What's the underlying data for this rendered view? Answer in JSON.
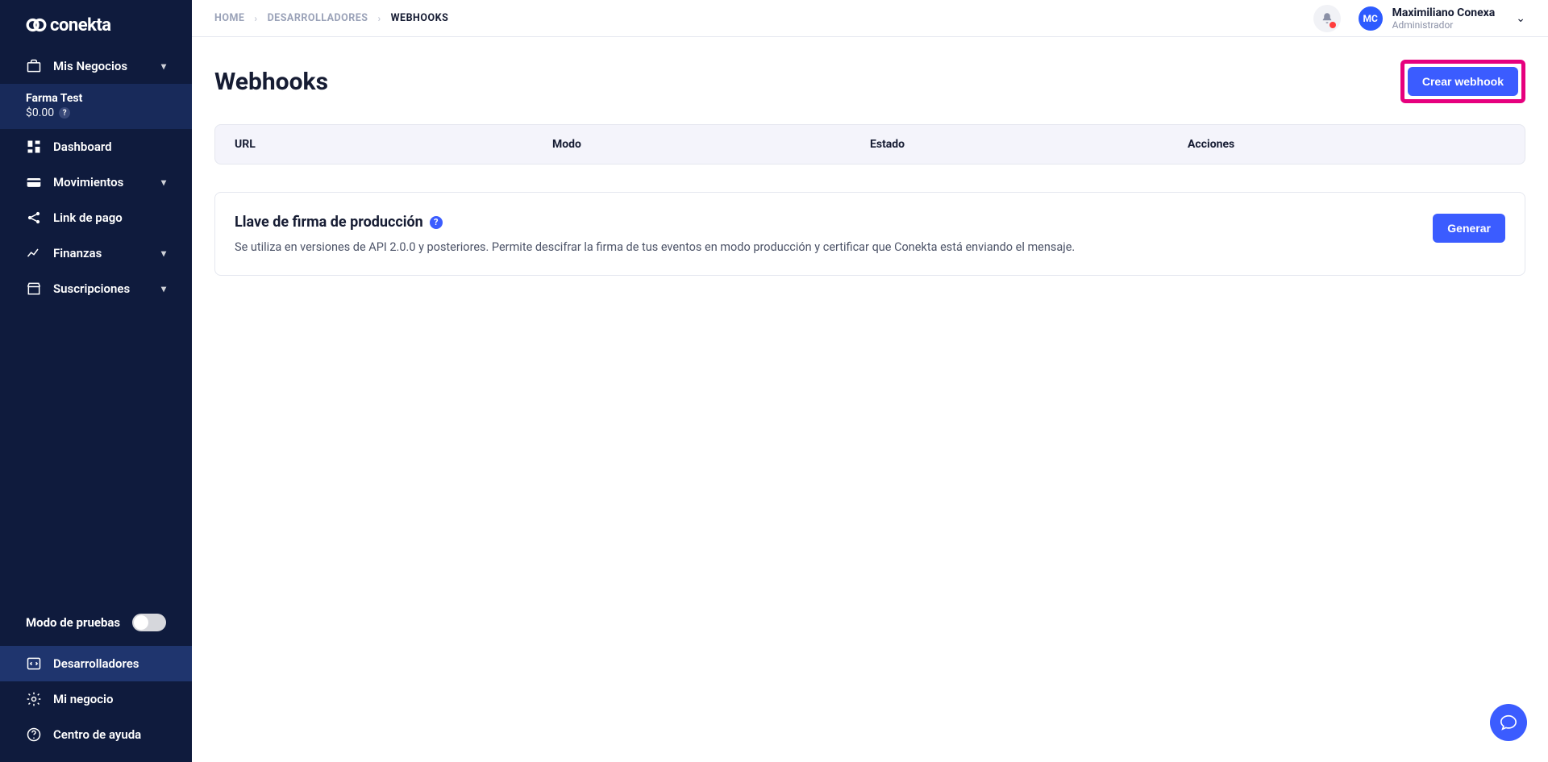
{
  "brand": {
    "name": "conekta"
  },
  "sidebar": {
    "misNegocios": "Mis Negocios",
    "account": {
      "name": "Farma Test",
      "balance": "$0.00"
    },
    "items": {
      "dashboard": "Dashboard",
      "movimientos": "Movimientos",
      "linkPago": "Link de pago",
      "finanzas": "Finanzas",
      "suscripciones": "Suscripciones"
    },
    "testMode": "Modo de pruebas",
    "bottom": {
      "desarrolladores": "Desarrolladores",
      "miNegocio": "Mi negocio",
      "centroAyuda": "Centro de ayuda"
    }
  },
  "breadcrumb": {
    "home": "HOME",
    "dev": "DESARROLLADORES",
    "current": "WEBHOOKS"
  },
  "user": {
    "initials": "MC",
    "name": "Maximiliano Conexa",
    "role": "Administrador"
  },
  "page": {
    "title": "Webhooks",
    "createButton": "Crear webhook",
    "columns": {
      "url": "URL",
      "modo": "Modo",
      "estado": "Estado",
      "acciones": "Acciones"
    },
    "signing": {
      "title": "Llave de firma de producción",
      "desc": "Se utiliza en versiones de API 2.0.0 y posteriores. Permite descifrar la firma de tus eventos en modo producción y certificar que Conekta está enviando el mensaje.",
      "generate": "Generar"
    }
  }
}
